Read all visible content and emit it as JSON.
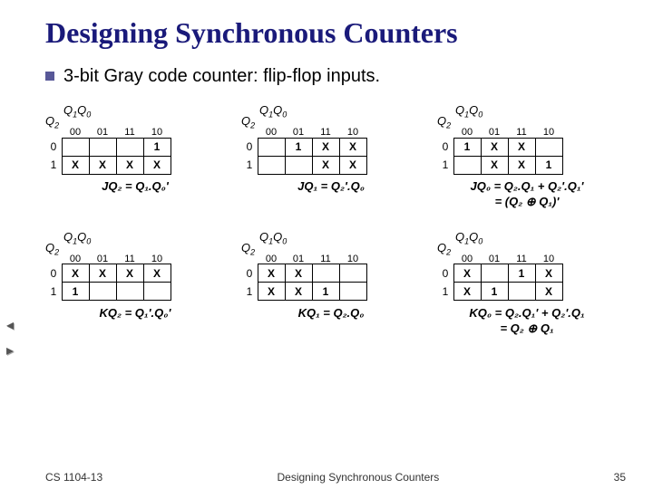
{
  "title": "Designing Synchronous Counters",
  "bullet": "3-bit Gray code counter: flip-flop inputs.",
  "khead_cols": [
    "00",
    "01",
    "11",
    "10"
  ],
  "khead_rows": [
    "0",
    "1"
  ],
  "col_var": "Q₁Q₀",
  "row_var": "Q₂",
  "kmaps": [
    {
      "cells": [
        [
          "",
          "",
          "",
          "1"
        ],
        [
          "X",
          "X",
          "X",
          "X"
        ]
      ],
      "caption": "JQ₂ = Q₁.Q₀'"
    },
    {
      "cells": [
        [
          "",
          "1",
          "X",
          "X"
        ],
        [
          "",
          "",
          "X",
          "X"
        ]
      ],
      "caption": "JQ₁ = Q₂'.Q₀"
    },
    {
      "cells": [
        [
          "1",
          "X",
          "X",
          ""
        ],
        [
          "",
          "X",
          "X",
          "1"
        ]
      ],
      "caption": "JQ₀ = Q₂.Q₁ + Q₂'.Q₁'\n= (Q₂ ⊕ Q₁)'"
    },
    {
      "cells": [
        [
          "X",
          "X",
          "X",
          "X"
        ],
        [
          "1",
          "",
          "",
          ""
        ]
      ],
      "caption": "KQ₂ = Q₁'.Q₀'"
    },
    {
      "cells": [
        [
          "X",
          "X",
          "",
          ""
        ],
        [
          "X",
          "X",
          "1",
          ""
        ]
      ],
      "caption": "KQ₁ = Q₂.Q₀"
    },
    {
      "cells": [
        [
          "X",
          "",
          "1",
          "X"
        ],
        [
          "X",
          "1",
          "",
          "X"
        ]
      ],
      "caption": "KQ₀ = Q₂.Q₁' + Q₂'.Q₁\n= Q₂ ⊕ Q₁"
    }
  ],
  "footer": {
    "left": "CS 1104-13",
    "center": "Designing Synchronous Counters",
    "right": "35"
  },
  "nav": {
    "prev": "◂",
    "next": "▸"
  }
}
